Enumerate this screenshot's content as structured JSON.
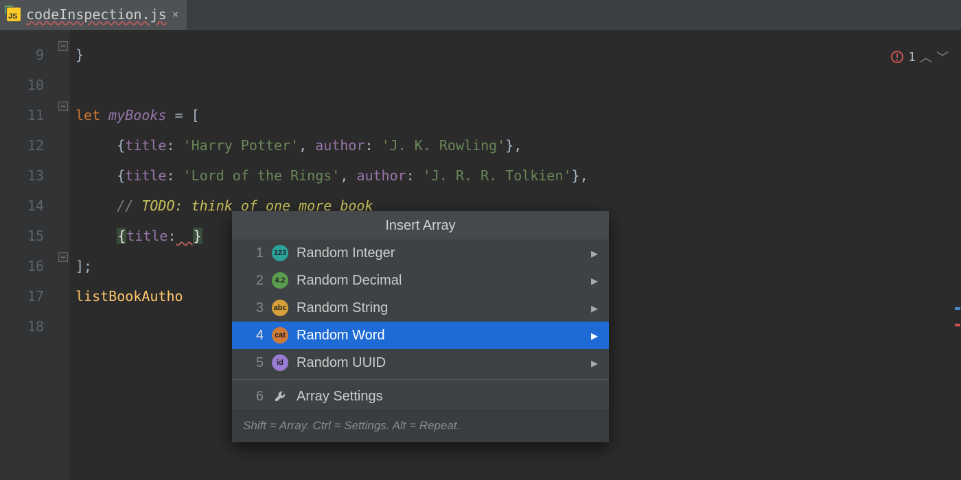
{
  "tab": {
    "filename": "codeInspection.js",
    "icon_label": "JS"
  },
  "inspection": {
    "count": "1"
  },
  "gutter": {
    "start": 9,
    "end": 18
  },
  "code": {
    "l9": "}",
    "l11_kw": "let",
    "l11_var": "myBooks",
    "l11_rest": " = [",
    "l12_t": "title",
    "l12_tv": "'Harry Potter'",
    "l12_a": "author",
    "l12_av": "'J. K. Rowling'",
    "l13_t": "title",
    "l13_tv": "'Lord of the Rings'",
    "l13_a": "author",
    "l13_av": "'J. R. R. Tolkien'",
    "l14_c": "// ",
    "l14_todo": "TODO: think of one more book",
    "l15_t": "title",
    "l16": "];",
    "l17_fn": "listBookAutho"
  },
  "popup": {
    "title": "Insert Array",
    "hint": "Shift = Array. Ctrl = Settings. Alt = Repeat.",
    "items": [
      {
        "n": "1",
        "icon_text": "123",
        "icon_bg": "#2aa39a",
        "label": "Random Integer",
        "submenu": true
      },
      {
        "n": "2",
        "icon_text": "4.2",
        "icon_bg": "#5b9e4d",
        "label": "Random Decimal",
        "submenu": true
      },
      {
        "n": "3",
        "icon_text": "abc",
        "icon_bg": "#d6a03a",
        "label": "Random String",
        "submenu": true
      },
      {
        "n": "4",
        "icon_text": "cat",
        "icon_bg": "#d07a3a",
        "label": "Random Word",
        "submenu": true,
        "selected": true
      },
      {
        "n": "5",
        "icon_text": "id",
        "icon_bg": "#9a7bd1",
        "label": "Random UUID",
        "submenu": true
      }
    ],
    "settings": {
      "n": "6",
      "label": "Array Settings"
    }
  }
}
